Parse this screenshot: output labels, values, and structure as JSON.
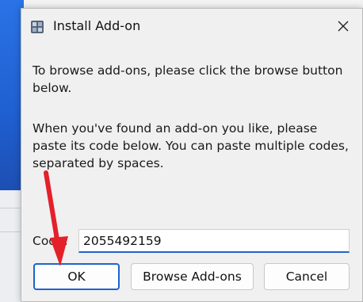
{
  "dialog": {
    "title": "Install Add-on",
    "close_icon": "close-icon",
    "app_icon": "addon-app-icon",
    "instruction_1": "To browse add-ons, please click the browse button below.",
    "instruction_2": "When you've found an add-on you like, please paste its code below. You can paste multiple codes, separated by spaces.",
    "code_label": "Code:",
    "code_value": "2055492159",
    "buttons": {
      "ok": "OK",
      "browse": "Browse Add-ons",
      "cancel": "Cancel"
    }
  },
  "annotation": {
    "arrow_color": "#e4202a",
    "arrow_icon": "red-arrow-pointer"
  },
  "colors": {
    "accent": "#1c64cf",
    "dialog_bg": "#f0f0f0"
  }
}
